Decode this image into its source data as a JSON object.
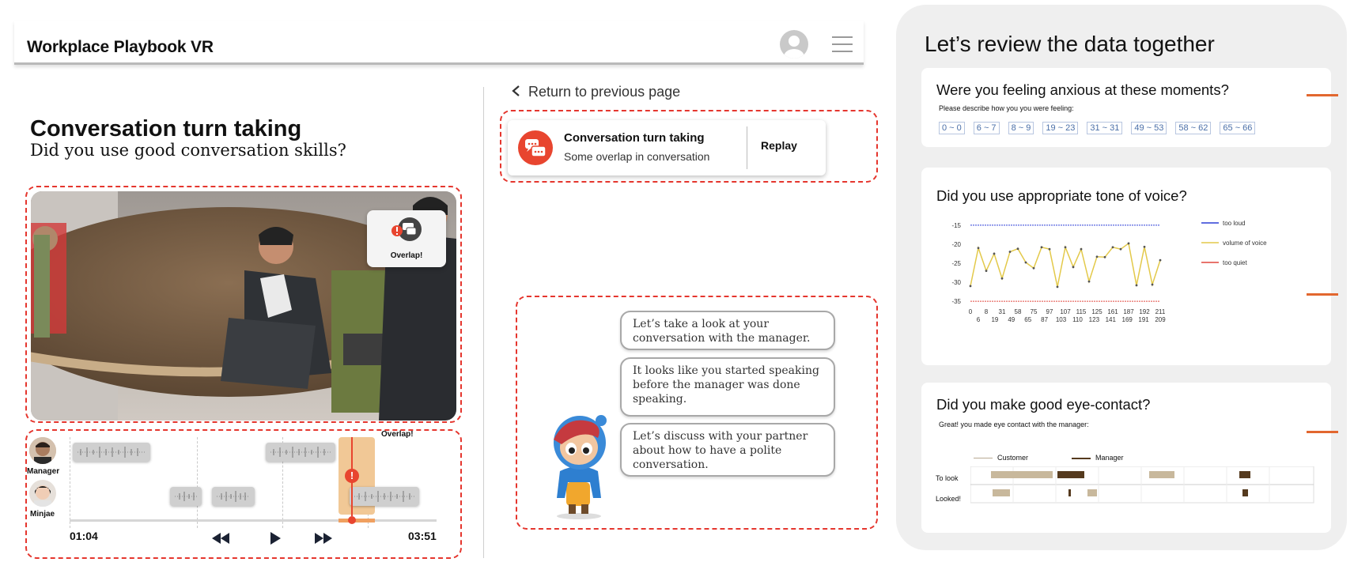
{
  "header": {
    "app_title": "Workplace Playbook VR"
  },
  "left": {
    "title": "Conversation turn taking",
    "subtitle": "Did you use good conversation skills?",
    "video_popup": "Overlap!",
    "timeline": {
      "overlap_label": "Overlap!",
      "speakers": [
        "Manager",
        "Minjae"
      ],
      "start_time": "01:04",
      "end_time": "03:51"
    }
  },
  "middle": {
    "back_link": "Return to previous page",
    "notification": {
      "title": "Conversation turn taking",
      "subtitle": "Some overlap in conversation",
      "action": "Replay"
    },
    "bubbles": [
      "Let’s take a look at your conversation with the manager.",
      "It looks like you started speaking before the manager was done speaking.",
      "Let’s discuss with your partner about how to have a polite conversation."
    ]
  },
  "right": {
    "title": "Let’s review the data together",
    "anxiety": {
      "question": "Were you feeling anxious at these moments?",
      "instruction": "Please describe how you you were feeling:",
      "ranges": [
        "0 ~ 0",
        "6 ~ 7",
        "8 ~ 9",
        "19 ~ 23",
        "31 ~ 31",
        "49 ~ 53",
        "58 ~ 62",
        "65 ~ 66"
      ]
    },
    "tone": {
      "question": "Did you use appropriate tone of voice?"
    },
    "eye": {
      "question": "Did you make good eye-contact?",
      "feedback": "Great! you made eye contact with the manager:",
      "legend": [
        "Customer",
        "Manager"
      ],
      "rows": [
        "To look",
        "Looked!"
      ]
    }
  },
  "chart_data": {
    "type": "line",
    "x_top": [
      0,
      8,
      31,
      58,
      75,
      97,
      107,
      115,
      125,
      161,
      187,
      192,
      211
    ],
    "x_bottom": [
      6,
      19,
      49,
      65,
      87,
      103,
      110,
      123,
      141,
      169,
      191,
      209
    ],
    "y_ticks": [
      -15,
      -20,
      -25,
      -30,
      -35
    ],
    "ylim": [
      -36,
      -14
    ],
    "series": [
      {
        "name": "too loud",
        "color": "#2c3fd6",
        "values": [
          -15,
          -15,
          -15,
          -15,
          -15,
          -15,
          -15,
          -15,
          -15,
          -15,
          -15,
          -15,
          -15,
          -15,
          -15,
          -15,
          -15,
          -15,
          -15,
          -15,
          -15,
          -15,
          -15,
          -15,
          -15
        ]
      },
      {
        "name": "volume of voice",
        "color": "#e3c94a",
        "values": [
          -31,
          -21,
          -27,
          -22.5,
          -29,
          -22,
          -21.2,
          -24.8,
          -26.3,
          -20.8,
          -21.3,
          -31.2,
          -20.8,
          -26,
          -21.3,
          -29.8,
          -23.3,
          -23.4,
          -20.8,
          -21.3,
          -19.8,
          -30.8,
          -20.7,
          -30.6,
          -24.2
        ]
      },
      {
        "name": "too quiet",
        "color": "#e0473d",
        "values": [
          -35,
          -35,
          -35,
          -35,
          -35,
          -35,
          -35,
          -35,
          -35,
          -35,
          -35,
          -35,
          -35,
          -35,
          -35,
          -35,
          -35,
          -35,
          -35,
          -35,
          -35,
          -35,
          -35,
          -35,
          -35
        ]
      }
    ]
  }
}
